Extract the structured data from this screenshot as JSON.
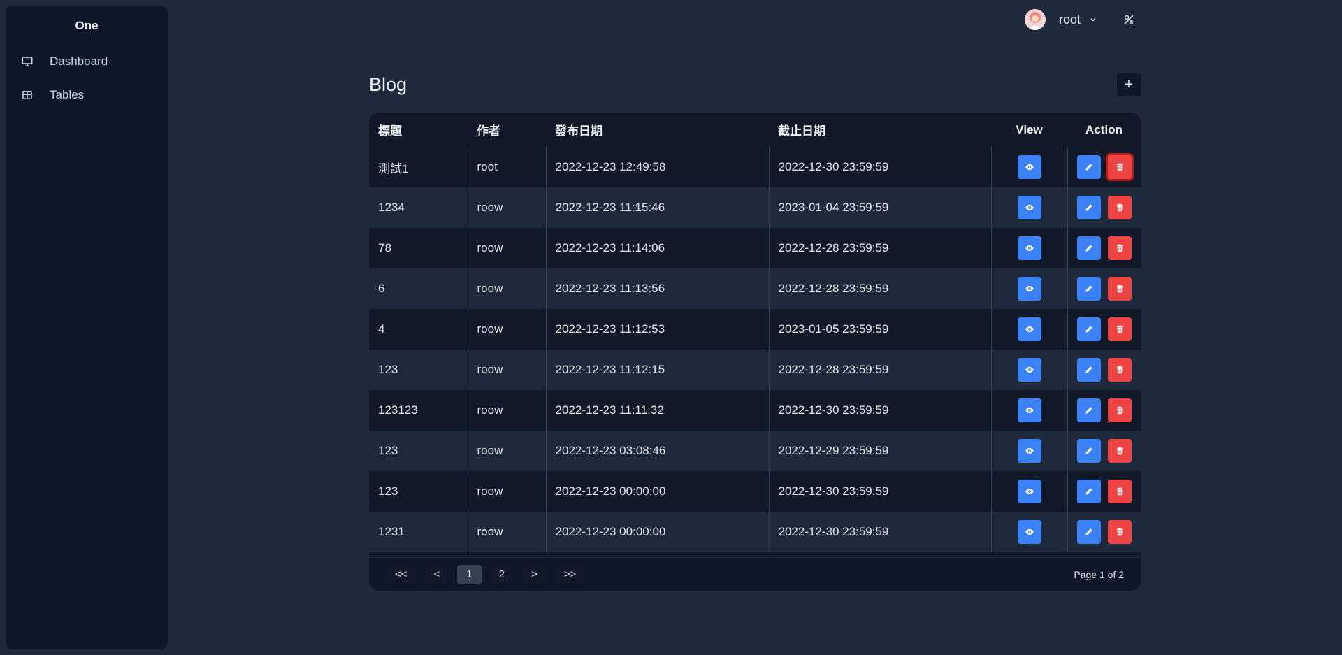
{
  "sidebar": {
    "brand": "One",
    "items": [
      {
        "label": "Dashboard",
        "icon": "monitor-icon"
      },
      {
        "label": "Tables",
        "icon": "table-icon"
      }
    ]
  },
  "header": {
    "username": "root"
  },
  "main": {
    "title": "Blog",
    "add_label": "+"
  },
  "table": {
    "columns": [
      "標題",
      "作者",
      "發布日期",
      "截止日期",
      "View",
      "Action"
    ],
    "rows": [
      {
        "title": "測試1",
        "author": "root",
        "published": "2022-12-23 12:49:58",
        "deadline": "2022-12-30 23:59:59"
      },
      {
        "title": "1234",
        "author": "roow",
        "published": "2022-12-23 11:15:46",
        "deadline": "2023-01-04 23:59:59"
      },
      {
        "title": "78",
        "author": "roow",
        "published": "2022-12-23 11:14:06",
        "deadline": "2022-12-28 23:59:59"
      },
      {
        "title": "6",
        "author": "roow",
        "published": "2022-12-23 11:13:56",
        "deadline": "2022-12-28 23:59:59"
      },
      {
        "title": "4",
        "author": "roow",
        "published": "2022-12-23 11:12:53",
        "deadline": "2023-01-05 23:59:59"
      },
      {
        "title": "123",
        "author": "roow",
        "published": "2022-12-23 11:12:15",
        "deadline": "2022-12-28 23:59:59"
      },
      {
        "title": "123123",
        "author": "roow",
        "published": "2022-12-23 11:11:32",
        "deadline": "2022-12-30 23:59:59"
      },
      {
        "title": "123",
        "author": "roow",
        "published": "2022-12-23 03:08:46",
        "deadline": "2022-12-29 23:59:59"
      },
      {
        "title": "123",
        "author": "roow",
        "published": "2022-12-23 00:00:00",
        "deadline": "2022-12-30 23:59:59"
      },
      {
        "title": "1231",
        "author": "roow",
        "published": "2022-12-23 00:00:00",
        "deadline": "2022-12-30 23:59:59"
      }
    ]
  },
  "pagination": {
    "first": "<<",
    "prev": "<",
    "pages": [
      "1",
      "2"
    ],
    "current": "1",
    "next": ">",
    "last": ">>",
    "info": "Page 1 of 2"
  },
  "colors": {
    "view_button": "#3b82f6",
    "edit_button": "#3b82f6",
    "delete_button": "#ef4444"
  }
}
